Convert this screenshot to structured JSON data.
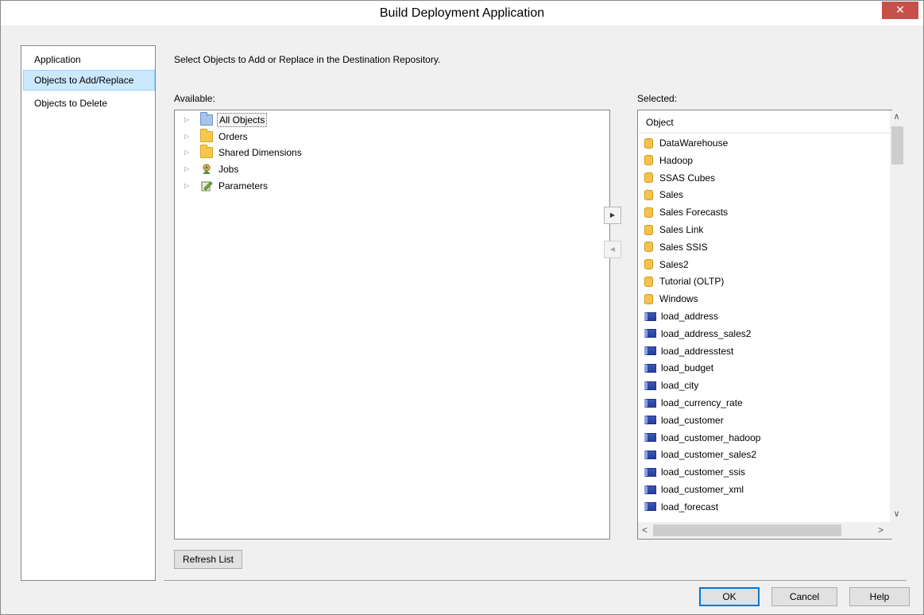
{
  "window": {
    "title": "Build Deployment Application",
    "close_glyph": "✕"
  },
  "nav": {
    "items": [
      {
        "label": "Application",
        "selected": false
      },
      {
        "label": "Objects to Add/Replace",
        "selected": true
      },
      {
        "label": "Objects to Delete",
        "selected": false
      }
    ]
  },
  "instruction": "Select Objects to Add or Replace in the Destination Repository.",
  "available": {
    "label": "Available:",
    "tree": [
      {
        "label": "All Objects",
        "icon": "folder-blue-icon"
      },
      {
        "label": "Orders",
        "icon": "folder-icon"
      },
      {
        "label": "Shared Dimensions",
        "icon": "folder-icon"
      },
      {
        "label": "Jobs",
        "icon": "jobs-icon"
      },
      {
        "label": "Parameters",
        "icon": "parameters-icon"
      }
    ],
    "refresh_label": "Refresh List"
  },
  "move_buttons": {
    "add_glyph": "▶",
    "remove_glyph": "◀"
  },
  "selected": {
    "label": "Selected:",
    "column_header": "Object",
    "items": [
      {
        "label": "DataWarehouse",
        "icon": "database-icon"
      },
      {
        "label": "Hadoop",
        "icon": "database-icon"
      },
      {
        "label": "SSAS Cubes",
        "icon": "database-icon"
      },
      {
        "label": "Sales",
        "icon": "database-icon"
      },
      {
        "label": "Sales Forecasts",
        "icon": "database-icon"
      },
      {
        "label": "Sales Link",
        "icon": "database-icon"
      },
      {
        "label": "Sales SSIS",
        "icon": "database-icon"
      },
      {
        "label": "Sales2",
        "icon": "database-icon"
      },
      {
        "label": "Tutorial (OLTP)",
        "icon": "database-icon"
      },
      {
        "label": "Windows",
        "icon": "database-icon"
      },
      {
        "label": "load_address",
        "icon": "table-icon"
      },
      {
        "label": "load_address_sales2",
        "icon": "table-icon"
      },
      {
        "label": "load_addresstest",
        "icon": "table-icon"
      },
      {
        "label": "load_budget",
        "icon": "table-icon"
      },
      {
        "label": "load_city",
        "icon": "table-icon"
      },
      {
        "label": "load_currency_rate",
        "icon": "table-icon"
      },
      {
        "label": "load_customer",
        "icon": "table-icon"
      },
      {
        "label": "load_customer_hadoop",
        "icon": "table-icon"
      },
      {
        "label": "load_customer_sales2",
        "icon": "table-icon"
      },
      {
        "label": "load_customer_ssis",
        "icon": "table-icon"
      },
      {
        "label": "load_customer_xml",
        "icon": "table-icon"
      },
      {
        "label": "load_forecast",
        "icon": "table-icon"
      }
    ],
    "scroll_glyphs": {
      "up": "∧",
      "down": "∨",
      "left": "<",
      "right": ">"
    }
  },
  "buttons": {
    "ok": "OK",
    "cancel": "Cancel",
    "help": "Help"
  }
}
